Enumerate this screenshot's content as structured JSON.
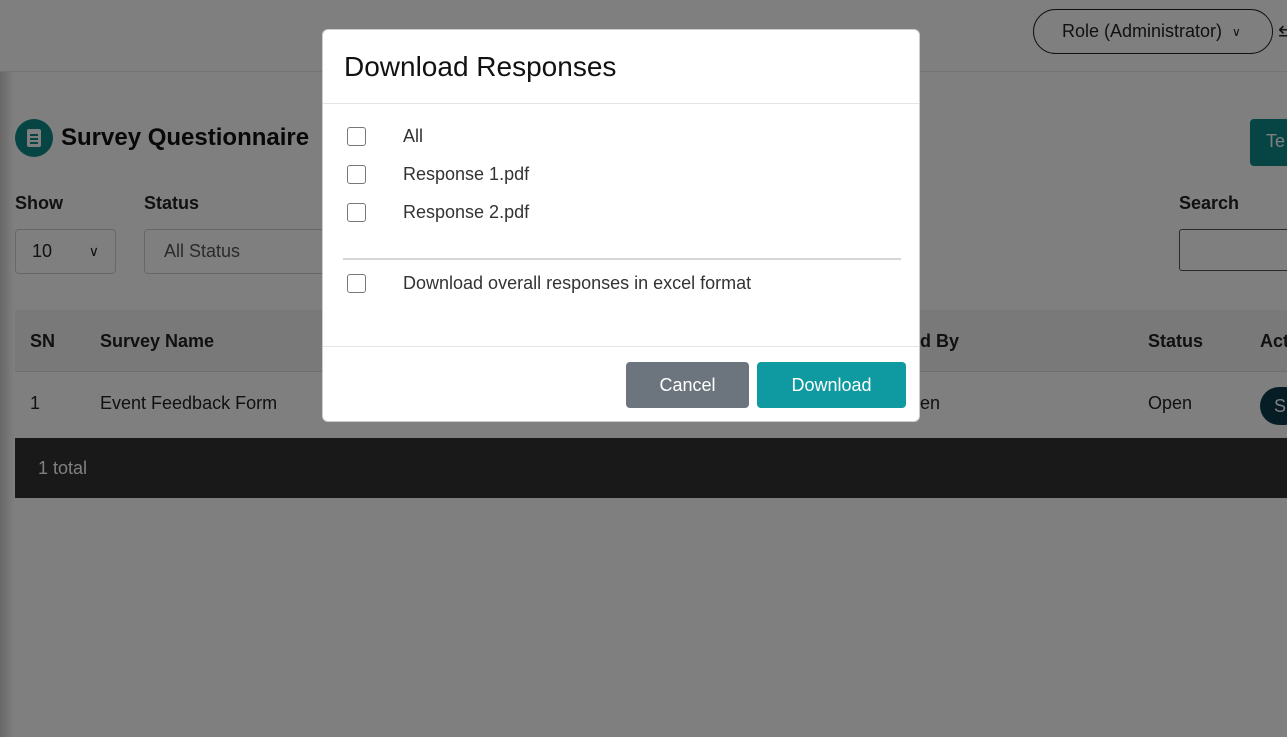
{
  "topbar": {
    "role_label": "Role (Administrator)"
  },
  "page": {
    "title": "Survey Questionnaire",
    "corner_button_label": "Te"
  },
  "filters": {
    "show_label": "Show",
    "show_value": "10",
    "status_label": "Status",
    "status_value": "All Status",
    "search_label": "Search"
  },
  "table": {
    "headers": {
      "sn": "SN",
      "name": "Survey Name",
      "created_by": "d By",
      "status": "Status",
      "action": "Act"
    },
    "rows": [
      {
        "sn": "1",
        "name": "Event Feedback Form",
        "created_by": "en",
        "status": "Open",
        "action": "S"
      }
    ],
    "footer": "1 total"
  },
  "modal": {
    "title": "Download Responses",
    "options": [
      "All",
      "Response 1.pdf",
      "Response 2.pdf"
    ],
    "excel_option": "Download overall responses in excel format",
    "cancel_label": "Cancel",
    "download_label": "Download"
  },
  "colors": {
    "accent": "#0e9aa0",
    "cancel": "#6c757d",
    "table_footer": "#333333",
    "view_button": "#0d3b4a"
  }
}
